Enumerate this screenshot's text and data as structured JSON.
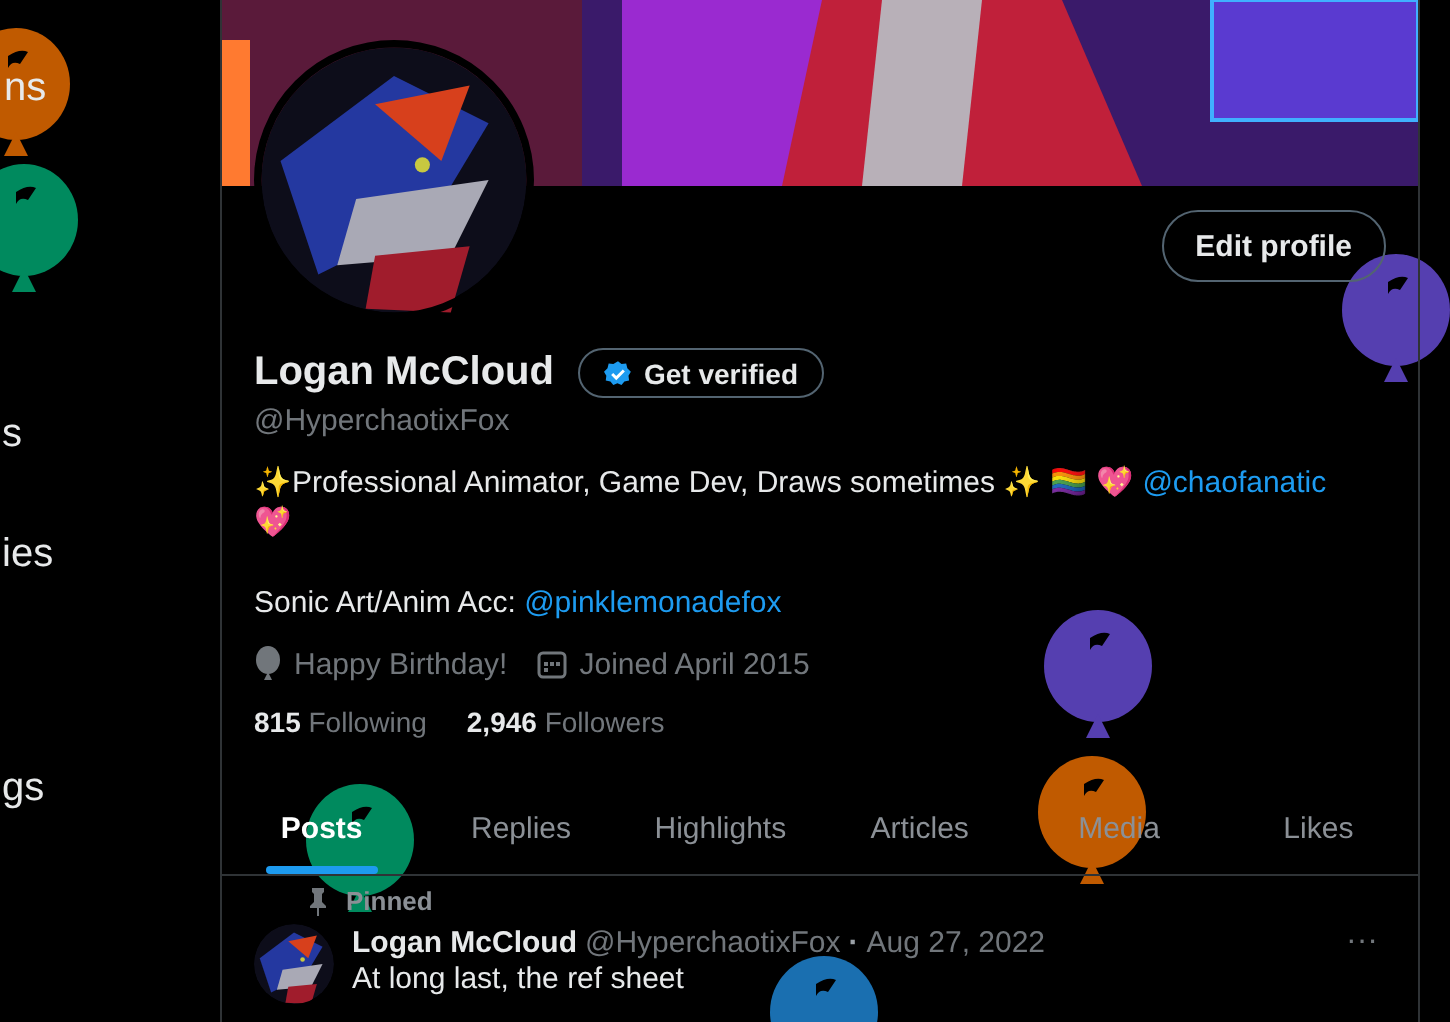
{
  "sidebar": {
    "items": [
      "ns",
      "s",
      "ies",
      "gs"
    ]
  },
  "profile": {
    "edit_button": "Edit profile",
    "name": "Logan McCloud",
    "verify_button": "Get verified",
    "handle": "@HyperchaotixFox",
    "bio": [
      [
        {
          "kind": "text",
          "text": "✨Professional Animator, Game Dev, Draws sometimes ✨ 🏳️‍🌈 💖 "
        },
        {
          "kind": "link",
          "text": "@chaofanatic"
        }
      ],
      [
        {
          "kind": "text",
          "text": "💖"
        }
      ],
      [
        {
          "kind": "text",
          "text": "Sonic Art/Anim Acc: "
        },
        {
          "kind": "link",
          "text": "@pinklemonadefox"
        }
      ]
    ],
    "meta": [
      {
        "kind": "balloon",
        "text": "Happy Birthday!"
      },
      {
        "kind": "calendar",
        "text": "Joined April 2015"
      }
    ],
    "stats": [
      {
        "count": "815",
        "label": "Following"
      },
      {
        "count": "2,946",
        "label": "Followers"
      }
    ]
  },
  "tabs": [
    {
      "label": "Posts",
      "selected": true
    },
    {
      "label": "Replies",
      "selected": false
    },
    {
      "label": "Highlights",
      "selected": false
    },
    {
      "label": "Articles",
      "selected": false
    },
    {
      "label": "Media",
      "selected": false
    },
    {
      "label": "Likes",
      "selected": false
    }
  ],
  "post": {
    "pinned_label": "Pinned",
    "author": "Logan McCloud",
    "handle": "@HyperchaotixFox",
    "separator": "·",
    "date": "Aug 27, 2022",
    "more": "···",
    "text": "At long last, the ref sheet"
  },
  "balloons": [
    {
      "color": "#c05a00"
    },
    {
      "color": "#008a5e"
    },
    {
      "color": "#553fb0"
    },
    {
      "color": "#553fb0"
    },
    {
      "color": "#008a5e"
    },
    {
      "color": "#c05a00"
    },
    {
      "color": "#1a6fb0"
    }
  ]
}
